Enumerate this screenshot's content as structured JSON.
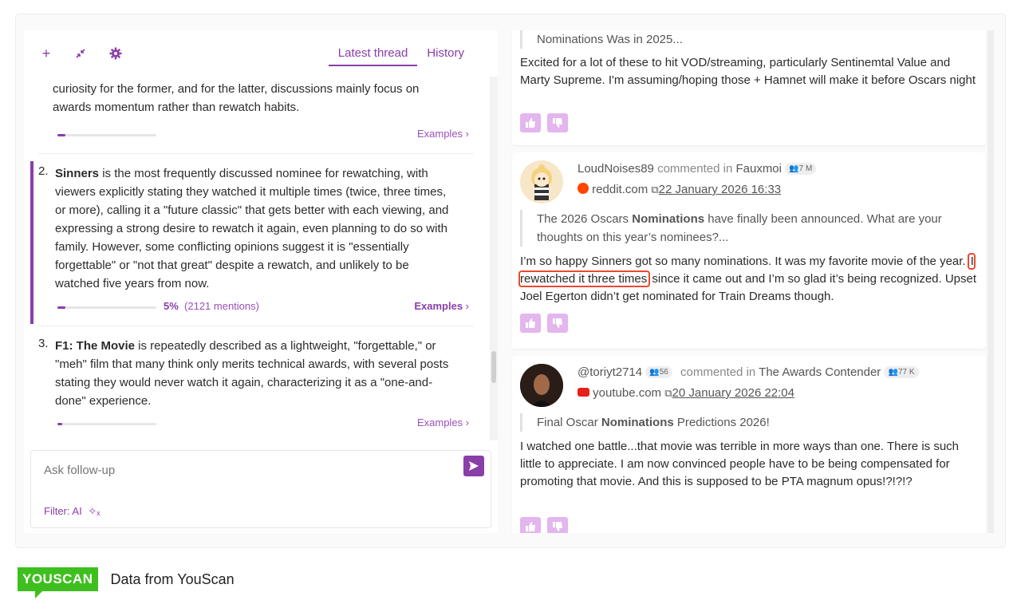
{
  "toolbar": {
    "tabs": [
      {
        "label": "Latest thread",
        "active": true
      },
      {
        "label": "History",
        "active": false
      }
    ]
  },
  "thread": {
    "item1_partial": "curiosity for the former, and for the latter, discussions mainly focus on awards momentum rather than rewatch habits.",
    "item1_examples": "Examples",
    "item2": {
      "number": "2.",
      "title": "Sinners",
      "text": " is the most frequently discussed nominee for rewatching, with viewers explicitly stating they watched it multiple times (twice, three times, or more), calling it a \"future classic\" that gets better with each viewing, and expressing a strong desire to rewatch it again, even planning to do so with family. However, some conflicting opinions suggest it is \"essentially forgettable\" or \"not that great\" despite a rewatch, and unlikely to be watched five years from now.",
      "percent": "5%",
      "mentions": "(2121 mentions)",
      "share": 0.05,
      "examples": "Examples"
    },
    "item3": {
      "number": "3.",
      "title": "F1: The Movie",
      "text": " is repeatedly described as a lightweight, \"forgettable,\" or \"meh\" film that many think only merits technical awards, with several posts stating they would never watch it again, characterizing it as a \"one-and-done\" experience.",
      "examples": "Examples"
    }
  },
  "ask": {
    "placeholder": "Ask follow-up",
    "filter": "Filter: AI"
  },
  "posts": [
    {
      "quote": "Nominations Was in 2025...",
      "text": "Excited for a lot of these to hit VOD/streaming, particularly Sentinemtal Value and Marty Supreme. I'm assuming/hoping those + Hamnet will make it before Oscars night"
    },
    {
      "author": "LoudNoises89",
      "commented_in": "commented in",
      "community": "Fauxmoi",
      "community_badge": "7 M",
      "source": "reddit.com",
      "date": "22 January 2026 16:33",
      "quote_pre": "The 2026 Oscars ",
      "quote_bold": "Nominations",
      "quote_post": " have finally been announced. What are your thoughts on this year’s nominees?...",
      "text_pre": "I’m so happy Sinners got so many nominations. It was my favorite movie of the year.",
      "text_hl": "I rewatched it three times",
      "text_post": " since it came out and I’m so glad it’s being recognized. Upset Joel Egerton didn’t get nominated for Train Dreams though."
    },
    {
      "author": "@toriyt2714",
      "author_badge": "56",
      "commented_in": "commented in",
      "community": "The Awards Contender",
      "community_badge": "77 K",
      "source": "youtube.com",
      "date": "20 January 2026 22:04",
      "quote_pre": "Final Oscar ",
      "quote_bold": "Nominations",
      "quote_post": " Predictions 2026!",
      "text": "I watched one battle...that movie was terrible in more ways than one. There is such little to appreciate. I am now convinced people have to be being compensated for promoting that movie. And this is supposed to be PTA magnum opus!?!?!?"
    }
  ],
  "footer": {
    "logo": "YOUSCAN",
    "text": "Data from YouScan"
  },
  "colors": {
    "accent": "#8a3ea8",
    "brand_green": "#3fbf1f",
    "highlight": "#e84a2e"
  }
}
